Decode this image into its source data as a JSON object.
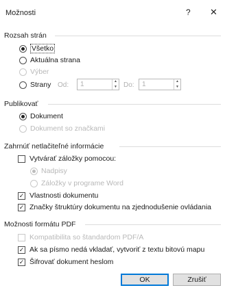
{
  "dialog": {
    "title": "Možnosti",
    "help_label": "?",
    "close_label": "✕"
  },
  "range": {
    "label": "Rozsah strán",
    "all": "Všetko",
    "current": "Aktuálna strana",
    "selection": "Výber",
    "pages": "Strany",
    "from_label": "Od:",
    "from_value": "1",
    "to_label": "Do:",
    "to_value": "1",
    "selected": "all"
  },
  "publish": {
    "label": "Publikovať",
    "document": "Dokument",
    "document_markup": "Dokument so značkami"
  },
  "nonprint": {
    "label": "Zahrnúť netlačiteľné informácie",
    "bookmarks": "Vytvárať záložky pomocou:",
    "headings": "Nadpisy",
    "word_bookmarks": "Záložky v programe Word",
    "doc_properties": "Vlastnosti dokumentu",
    "structure_tags": "Značky štruktúry dokumentu na zjednodušenie ovládania"
  },
  "pdf": {
    "label": "Možnosti formátu PDF",
    "pdfa": "Kompatibilita so štandardom PDF/A",
    "bitmap": "Ak sa písmo nedá vkladať, vytvoriť z textu bitovú mapu",
    "encrypt": "Šifrovať dokument heslom"
  },
  "buttons": {
    "ok": "OK",
    "cancel": "Zrušiť"
  },
  "colors": {
    "default_button_border": "#0078d7",
    "disabled_text": "#b8b8b8"
  }
}
